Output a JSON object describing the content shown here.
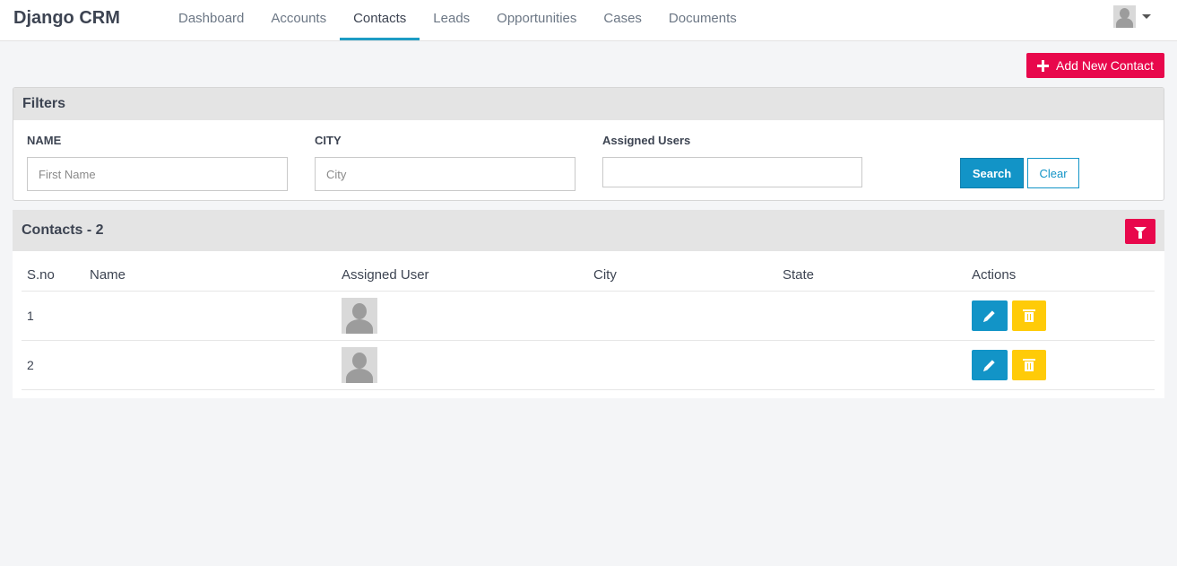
{
  "app": {
    "brand": "Django CRM"
  },
  "nav": {
    "items": [
      {
        "label": "Dashboard",
        "active": false
      },
      {
        "label": "Accounts",
        "active": false
      },
      {
        "label": "Contacts",
        "active": true
      },
      {
        "label": "Leads",
        "active": false
      },
      {
        "label": "Opportunities",
        "active": false
      },
      {
        "label": "Cases",
        "active": false
      },
      {
        "label": "Documents",
        "active": false
      }
    ]
  },
  "toolbar": {
    "add_label": "Add New Contact"
  },
  "filters": {
    "title": "Filters",
    "name_label": "NAME",
    "name_placeholder": "First Name",
    "city_label": "CITY",
    "city_placeholder": "City",
    "users_label": "Assigned Users",
    "search_label": "Search",
    "clear_label": "Clear"
  },
  "contacts": {
    "title": "Contacts - 2",
    "columns": [
      "S.no",
      "Name",
      "Assigned User",
      "City",
      "State",
      "Actions"
    ],
    "rows": [
      {
        "sno": "1",
        "name": "",
        "city": "",
        "state": ""
      },
      {
        "sno": "2",
        "name": "",
        "city": "",
        "state": ""
      }
    ]
  },
  "colors": {
    "accent": "#e8084c",
    "primary": "#1294c7",
    "warning": "#ffcb08"
  }
}
